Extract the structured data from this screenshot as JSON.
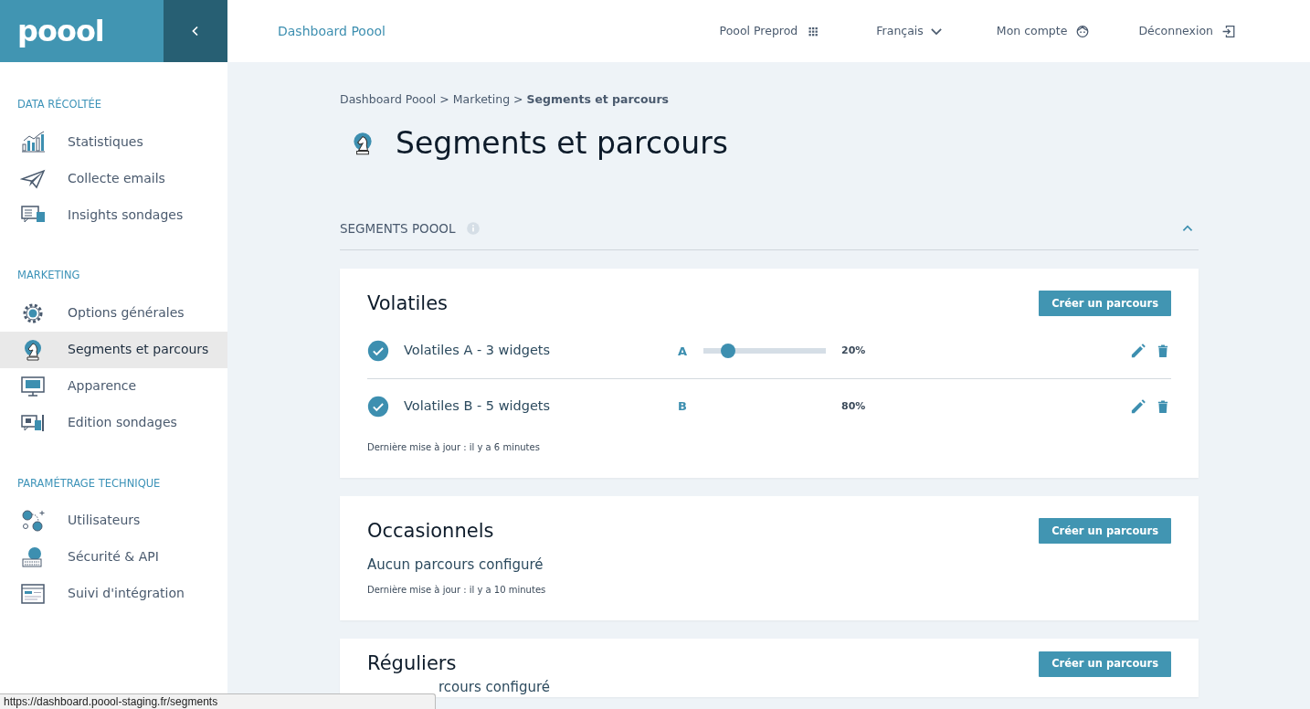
{
  "logo": "poool",
  "header": {
    "title": "Dashboard Poool",
    "nav": [
      {
        "label": "Poool Preprod"
      },
      {
        "label": "Français"
      },
      {
        "label": "Mon compte"
      },
      {
        "label": "Déconnexion"
      }
    ]
  },
  "sidebar": [
    {
      "title": "DATA RÉCOLTÉE",
      "items": [
        {
          "label": "Statistiques",
          "selected": false
        },
        {
          "label": "Collecte emails",
          "selected": false
        },
        {
          "label": "Insights sondages",
          "selected": false
        }
      ]
    },
    {
      "title": "MARKETING",
      "items": [
        {
          "label": "Options générales",
          "selected": false
        },
        {
          "label": "Segments et parcours",
          "selected": true
        },
        {
          "label": "Apparence",
          "selected": false
        },
        {
          "label": "Edition sondages",
          "selected": false
        }
      ]
    },
    {
      "title": "PARAMÉTRAGE TECHNIQUE",
      "items": [
        {
          "label": "Utilisateurs",
          "selected": false
        },
        {
          "label": "Sécurité & API",
          "selected": false
        },
        {
          "label": "Suivi d'intégration",
          "selected": false
        }
      ]
    }
  ],
  "breadcrumb": [
    {
      "label": "Dashboard Poool",
      "current": false,
      "separator": ">"
    },
    {
      "label": "Marketing",
      "current": false,
      "separator": ">"
    },
    {
      "label": "Segments et parcours",
      "current": true
    }
  ],
  "page_title": "Segments et parcours",
  "section": {
    "title": "SEGMENTS POOOL",
    "expanded": true
  },
  "segments": [
    {
      "title": "Volatiles",
      "button": "Créer un parcours",
      "rows": [
        {
          "name": "Volatiles A - 3 widgets",
          "letter": "A",
          "kind": "slider",
          "level": 0.2,
          "reading": "20%",
          "checked": true
        },
        {
          "name": "Volatiles B - 5 widgets",
          "letter": "B",
          "kind": "plain",
          "reading": "80%",
          "checked": true
        }
      ],
      "updated": "Dernière mise à jour : il y a 6 minutes"
    },
    {
      "title": "Occasionnels",
      "button": "Créer un parcours",
      "empty": "Aucun parcours configuré",
      "updated": "Dernière mise à jour : il y a 10 minutes"
    },
    {
      "title": "Réguliers",
      "button": "Créer un parcours",
      "empty": "rcours configuré"
    }
  ],
  "status_bar": "https://dashboard.poool-staging.fr/segments"
}
